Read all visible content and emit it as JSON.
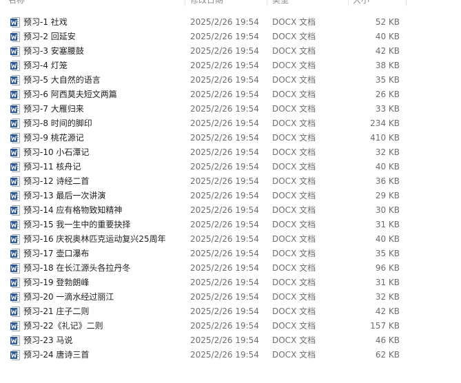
{
  "header": {
    "name": "名称",
    "date": "修改日期",
    "type": "类型",
    "size": "大小"
  },
  "icon_name": "word-document-icon",
  "colors": {
    "word_blue": "#2b5797"
  },
  "files": [
    {
      "name": "预习-1 社戏",
      "date": "2025/2/26 19:54",
      "type": "DOCX 文档",
      "size": "52 KB"
    },
    {
      "name": "预习-2 回延安",
      "date": "2025/2/26 19:54",
      "type": "DOCX 文档",
      "size": "40 KB"
    },
    {
      "name": "预习-3 安塞腰鼓",
      "date": "2025/2/26 19:54",
      "type": "DOCX 文档",
      "size": "42 KB"
    },
    {
      "name": "预习-4 灯笼",
      "date": "2025/2/26 19:54",
      "type": "DOCX 文档",
      "size": "38 KB"
    },
    {
      "name": "预习-5 大自然的语言",
      "date": "2025/2/26 19:54",
      "type": "DOCX 文档",
      "size": "35 KB"
    },
    {
      "name": "预习-6 阿西莫夫短文两篇",
      "date": "2025/2/26 19:54",
      "type": "DOCX 文档",
      "size": "26 KB"
    },
    {
      "name": "预习-7 大雁归来",
      "date": "2025/2/26 19:54",
      "type": "DOCX 文档",
      "size": "33 KB"
    },
    {
      "name": "预习-8 时间的脚印",
      "date": "2025/2/26 19:54",
      "type": "DOCX 文档",
      "size": "234 KB"
    },
    {
      "name": "预习-9 桃花源记",
      "date": "2025/2/26 19:54",
      "type": "DOCX 文档",
      "size": "410 KB"
    },
    {
      "name": "预习-10 小石潭记",
      "date": "2025/2/26 19:54",
      "type": "DOCX 文档",
      "size": "32 KB"
    },
    {
      "name": "预习-11 核舟记",
      "date": "2025/2/26 19:54",
      "type": "DOCX 文档",
      "size": "40 KB"
    },
    {
      "name": "预习-12 诗经二首",
      "date": "2025/2/26 19:54",
      "type": "DOCX 文档",
      "size": "36 KB"
    },
    {
      "name": "预习-13 最后一次讲演",
      "date": "2025/2/26 19:54",
      "type": "DOCX 文档",
      "size": "29 KB"
    },
    {
      "name": "预习-14 应有格物致知精神",
      "date": "2025/2/26 19:54",
      "type": "DOCX 文档",
      "size": "30 KB"
    },
    {
      "name": "预习-15 我一生中的重要抉择",
      "date": "2025/2/26 19:54",
      "type": "DOCX 文档",
      "size": "31 KB"
    },
    {
      "name": "预习-16 庆祝奥林匹克运动复兴25周年",
      "date": "2025/2/26 19:54",
      "type": "DOCX 文档",
      "size": "40 KB"
    },
    {
      "name": "预习-17 壶口瀑布",
      "date": "2025/2/26 19:54",
      "type": "DOCX 文档",
      "size": "35 KB"
    },
    {
      "name": "预习-18 在长江源头各拉丹冬",
      "date": "2025/2/26 19:54",
      "type": "DOCX 文档",
      "size": "96 KB"
    },
    {
      "name": "预习-19 登勃朗峰",
      "date": "2025/2/26 19:54",
      "type": "DOCX 文档",
      "size": "31 KB"
    },
    {
      "name": "预习-20 一滴水经过丽江",
      "date": "2025/2/26 19:54",
      "type": "DOCX 文档",
      "size": "32 KB"
    },
    {
      "name": "预习-21 庄子二则",
      "date": "2025/2/26 19:54",
      "type": "DOCX 文档",
      "size": "42 KB"
    },
    {
      "name": "预习-22《礼记》二则",
      "date": "2025/2/26 19:54",
      "type": "DOCX 文档",
      "size": "157 KB"
    },
    {
      "name": "预习-23 马说",
      "date": "2025/2/26 19:54",
      "type": "DOCX 文档",
      "size": "46 KB"
    },
    {
      "name": "预习-24 唐诗三首",
      "date": "2025/2/26 19:54",
      "type": "DOCX 文档",
      "size": "62 KB"
    }
  ]
}
